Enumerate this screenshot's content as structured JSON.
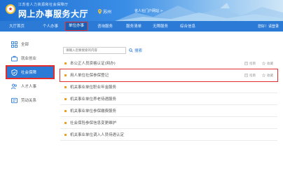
{
  "header": {
    "org_name": "江苏省人力资源和社会保障厅",
    "site_title": "网上办事服务大厅",
    "location": "苏州",
    "portal_link": "省人社门户网站 >"
  },
  "nav": {
    "items": [
      "大厅首页",
      "个人办事",
      "单位办事",
      "咨询服务",
      "服务清单",
      "无障服务",
      "综合信息"
    ],
    "active_index": 2,
    "right_link": "您好！请登录"
  },
  "sidebar": {
    "items": [
      {
        "label": "全部",
        "icon": "grid-icon"
      },
      {
        "label": "就业创业",
        "icon": "briefcase-icon"
      },
      {
        "label": "社会保障",
        "icon": "shield-icon"
      },
      {
        "label": "人才人事",
        "icon": "people-icon"
      },
      {
        "label": "劳动关系",
        "icon": "handshake-icon"
      }
    ],
    "active_index": 2
  },
  "search": {
    "placeholder": "请输入您要搜索的内容",
    "button_label": "搜索"
  },
  "list": {
    "guide_label": "指南",
    "fav_label": "收藏",
    "items": [
      {
        "title": "本公正人员资格认证(网办)",
        "has_actions": true,
        "highlighted": false
      },
      {
        "title": "用人单位社保参保登记",
        "has_actions": true,
        "highlighted": true
      },
      {
        "title": "机关事业单位职业年金服务",
        "has_actions": false,
        "highlighted": false
      },
      {
        "title": "机关事业单位养老待遇服务",
        "has_actions": false,
        "highlighted": false
      },
      {
        "title": "机关事业单位参保缴费服务",
        "has_actions": false,
        "highlighted": false
      },
      {
        "title": "社会保险参保信息变更维护",
        "has_actions": false,
        "highlighted": false
      },
      {
        "title": "机关事业单位调入人员待遇认定",
        "has_actions": false,
        "highlighted": false
      }
    ]
  },
  "colors": {
    "primary": "#2a7ad6",
    "highlight_border": "#e32d2d",
    "bullet": "#f0a020"
  }
}
